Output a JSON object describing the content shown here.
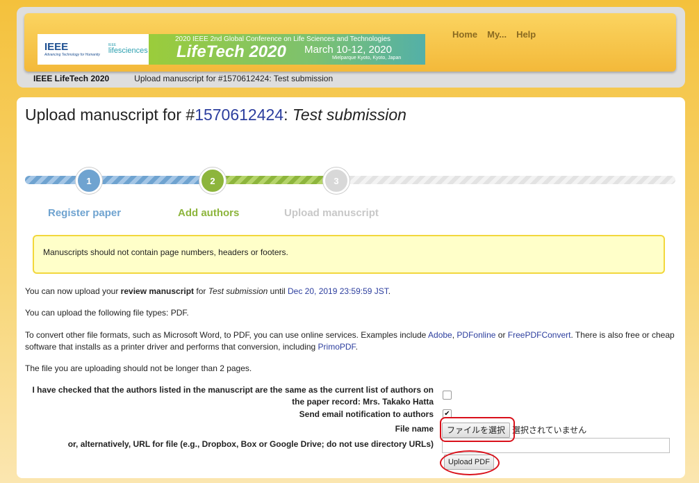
{
  "banner": {
    "ieee": "IEEE",
    "ieee_sub": "Advancing Technology for Humanity",
    "ls_prefix": "IEEE",
    "ls_name": "lifesciences",
    "conf_line": "2020 IEEE 2nd Global Conference on Life Sciences and Technologies",
    "conf_title": "LifeTech 2020",
    "conf_dates": "March 10-12, 2020",
    "conf_location": "Mielparque Kyoto, Kyoto, Japan"
  },
  "nav": {
    "home": "Home",
    "my": "My...",
    "help": "Help"
  },
  "breadcrumb": {
    "conference": "IEEE LifeTech 2020",
    "page": "Upload manuscript for #1570612424: Test submission"
  },
  "heading": {
    "prefix": "Upload manuscript for #",
    "paper_id": "1570612424",
    "sep": ": ",
    "title": "Test submission"
  },
  "steps": [
    {
      "num": "1",
      "label": "Register paper"
    },
    {
      "num": "2",
      "label": "Add authors"
    },
    {
      "num": "3",
      "label": "Upload manuscript"
    }
  ],
  "alert": "Manuscripts should not contain page numbers, headers or footers.",
  "info": {
    "line1_pre": "You can now upload your ",
    "line1_bold": "review manuscript",
    "line1_mid": " for ",
    "line1_title": "Test submission",
    "line1_until": " until ",
    "line1_deadline": "Dec 20, 2019 23:59:59 JST",
    "line1_end": ".",
    "line2": "You can upload the following file types: PDF.",
    "line3_pre": "To convert other file formats, such as Microsoft Word, to PDF, you can use online services. Examples include ",
    "adobe": "Adobe",
    "pdfonline": "PDFonline",
    "or": " or ",
    "freepdf": "FreePDFConvert",
    "line3_mid": ". There is also free or cheap software that installs as a printer driver and performs that conversion, including ",
    "primopdf": "PrimoPDF",
    "comma": ", ",
    "line4": "The file you are uploading should not be longer than 2 pages."
  },
  "form": {
    "authors_check_label": "I have checked that the authors listed in the manuscript are the same as the current list of authors on the paper record: Mrs. Takako Hatta",
    "authors_checked": false,
    "email_label": "Send email notification to authors",
    "email_checked": true,
    "email_check_mark": "✔",
    "file_label": "File name",
    "file_button": "ファイルを選択",
    "file_status": "選択されていません",
    "url_label": "or, alternatively, URL for file (e.g., Dropbox, Box or Google Drive; do not use directory URLs)",
    "url_value": "",
    "upload_button": "Upload PDF"
  },
  "colors": {
    "step1": "#6fa3d0",
    "step2": "#8db53c",
    "step3": "#d8d8d8",
    "highlight_ring": "#d9101a",
    "alert_bg": "#ffffc9"
  }
}
